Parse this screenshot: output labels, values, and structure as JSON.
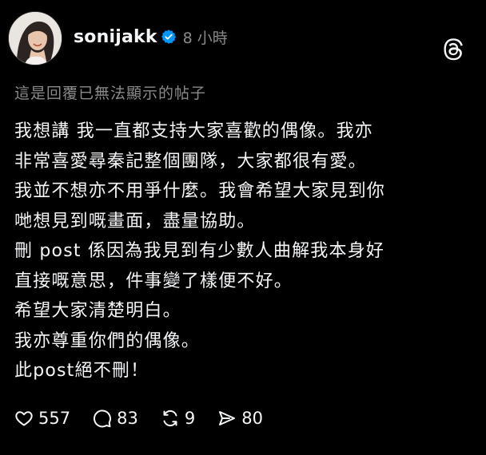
{
  "post": {
    "username": "sonijakk",
    "timestamp": "8 小時",
    "verified_color": "#0095f6",
    "reply_note": "這是回覆已無法顯示的帖子",
    "lines": [
      "我想講 我一直都支持大家喜歡的偶像。我亦",
      "非常喜愛尋秦記整個團隊，大家都很有愛。",
      "我並不想亦不用爭什麼。我會希望大家見到你",
      "哋想見到嘅畫面，盡量協助。",
      "刪 post 係因為我見到有少數人曲解我本身好",
      "直接嘅意思，件事變了樣便不好。",
      "希望大家清楚明白。",
      "我亦尊重你們的偶像。",
      "此post絕不刪！"
    ]
  },
  "actions": {
    "like": {
      "icon": "heart-icon",
      "count": "557"
    },
    "comment": {
      "icon": "comment-icon",
      "count": "83"
    },
    "repost": {
      "icon": "repost-icon",
      "count": "9"
    },
    "share": {
      "icon": "send-icon",
      "count": "80"
    }
  },
  "theme": {
    "background": "#000000",
    "text": "#f3f5f7",
    "muted": "#8a8a8a"
  }
}
